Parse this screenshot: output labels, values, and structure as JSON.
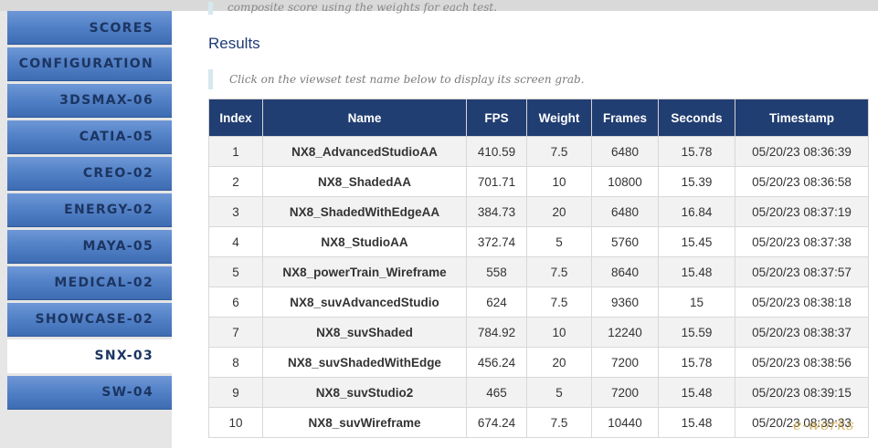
{
  "sidebar": {
    "items": [
      {
        "label": "SCORES",
        "active": false
      },
      {
        "label": "CONFIGURATION",
        "active": false
      },
      {
        "label": "3DSMAX-06",
        "active": false
      },
      {
        "label": "CATIA-05",
        "active": false
      },
      {
        "label": "CREO-02",
        "active": false
      },
      {
        "label": "ENERGY-02",
        "active": false
      },
      {
        "label": "MAYA-05",
        "active": false
      },
      {
        "label": "MEDICAL-02",
        "active": false
      },
      {
        "label": "SHOWCASE-02",
        "active": false
      },
      {
        "label": "SNX-03",
        "active": true
      },
      {
        "label": "SW-04",
        "active": false
      }
    ]
  },
  "main": {
    "intro_note": "composite score using the weights for each test.",
    "results_heading": "Results",
    "hint": "Click on the viewset test name below to display its screen grab.",
    "table": {
      "headers": [
        "Index",
        "Name",
        "FPS",
        "Weight",
        "Frames",
        "Seconds",
        "Timestamp"
      ],
      "rows": [
        [
          "1",
          "NX8_AdvancedStudioAA",
          "410.59",
          "7.5",
          "6480",
          "15.78",
          "05/20/23 08:36:39"
        ],
        [
          "2",
          "NX8_ShadedAA",
          "701.71",
          "10",
          "10800",
          "15.39",
          "05/20/23 08:36:58"
        ],
        [
          "3",
          "NX8_ShadedWithEdgeAA",
          "384.73",
          "20",
          "6480",
          "16.84",
          "05/20/23 08:37:19"
        ],
        [
          "4",
          "NX8_StudioAA",
          "372.74",
          "5",
          "5760",
          "15.45",
          "05/20/23 08:37:38"
        ],
        [
          "5",
          "NX8_powerTrain_Wireframe",
          "558",
          "7.5",
          "8640",
          "15.48",
          "05/20/23 08:37:57"
        ],
        [
          "6",
          "NX8_suvAdvancedStudio",
          "624",
          "7.5",
          "9360",
          "15",
          "05/20/23 08:38:18"
        ],
        [
          "7",
          "NX8_suvShaded",
          "784.92",
          "10",
          "12240",
          "15.59",
          "05/20/23 08:38:37"
        ],
        [
          "8",
          "NX8_suvShadedWithEdge",
          "456.24",
          "20",
          "7200",
          "15.78",
          "05/20/23 08:38:56"
        ],
        [
          "9",
          "NX8_suvStudio2",
          "465",
          "5",
          "7200",
          "15.48",
          "05/20/23 08:39:15"
        ],
        [
          "10",
          "NX8_suvWireframe",
          "674.24",
          "7.5",
          "10440",
          "15.48",
          "05/20/23 08:39:33"
        ]
      ]
    }
  },
  "watermark": "e-works",
  "colors": {
    "nav_blue": "#5180c6",
    "nav_text": "#1c3561",
    "header_bg": "#213e72",
    "heading_text": "#1f3a75"
  }
}
